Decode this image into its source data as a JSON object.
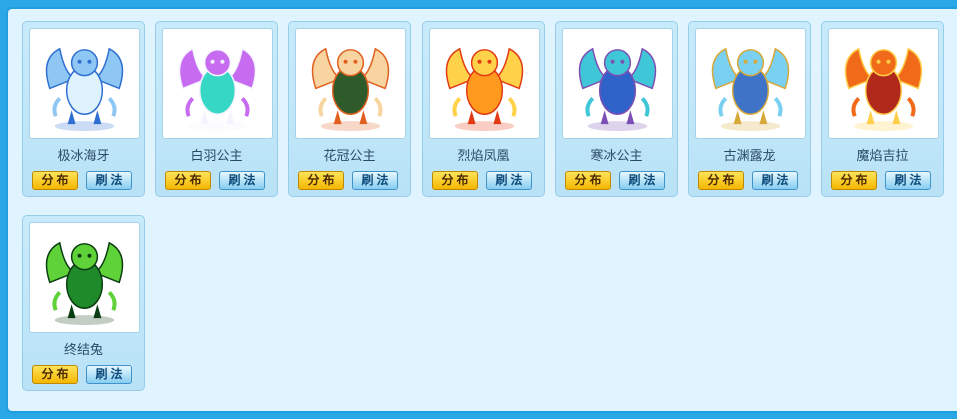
{
  "pets": [
    {
      "name": "极冰海牙",
      "icon": "ice-beast-icon",
      "colors": [
        "#dff3ff",
        "#8fc7f4",
        "#2f6fd1"
      ]
    },
    {
      "name": "白羽公主",
      "icon": "winged-princess-icon",
      "colors": [
        "#37d7c6",
        "#c76cf0",
        "#f4f4ff"
      ]
    },
    {
      "name": "花冠公主",
      "icon": "flower-princess-icon",
      "colors": [
        "#2f5a2a",
        "#f7d4a0",
        "#e06020"
      ]
    },
    {
      "name": "烈焰凤凰",
      "icon": "fire-phoenix-icon",
      "colors": [
        "#ff9a1e",
        "#ffd24a",
        "#e23a12"
      ]
    },
    {
      "name": "寒冰公主",
      "icon": "frost-princess-icon",
      "colors": [
        "#2f63c9",
        "#3fc7d8",
        "#7d4fb5"
      ]
    },
    {
      "name": "古渊露龙",
      "icon": "abyss-dragon-icon",
      "colors": [
        "#3f73c8",
        "#7ad0f0",
        "#d7a83a"
      ]
    },
    {
      "name": "魔焰吉拉",
      "icon": "flame-ogre-icon",
      "colors": [
        "#b1291a",
        "#f06a1a",
        "#ffcf4a"
      ]
    },
    {
      "name": "终结兔",
      "icon": "green-mantis-icon",
      "colors": [
        "#1f8a2a",
        "#5fd23a",
        "#0b3d12"
      ]
    }
  ],
  "buttons": {
    "distribution": "分布",
    "brush": "刷法"
  }
}
